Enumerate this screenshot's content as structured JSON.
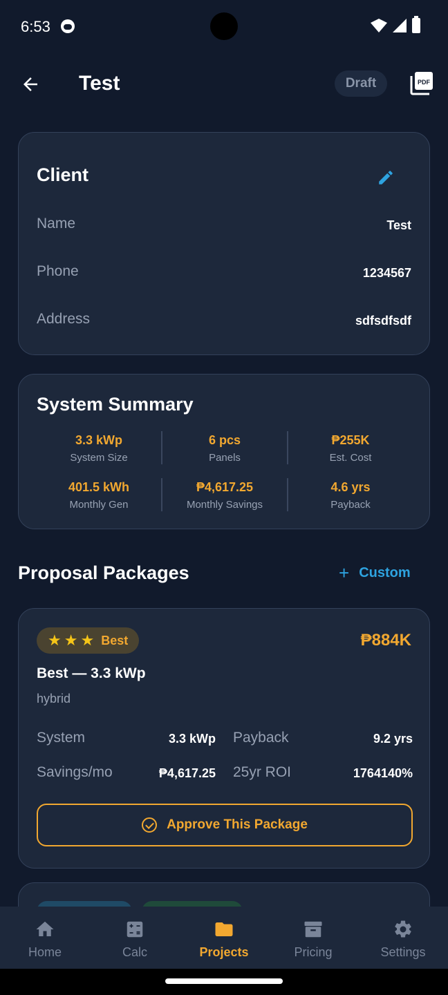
{
  "status_bar": {
    "time": "6:53"
  },
  "header": {
    "title": "Test",
    "status_chip": "Draft",
    "pdf_label": "PDF"
  },
  "client": {
    "title": "Client",
    "rows": [
      {
        "label": "Name",
        "value": "Test"
      },
      {
        "label": "Phone",
        "value": "1234567"
      },
      {
        "label": "Address",
        "value": "sdfsdfsdf"
      }
    ]
  },
  "summary": {
    "title": "System Summary",
    "stats": [
      {
        "value": "3.3 kWp",
        "label": "System Size"
      },
      {
        "value": "6 pcs",
        "label": "Panels"
      },
      {
        "value": "₱255K",
        "label": "Est. Cost"
      },
      {
        "value": "401.5 kWh",
        "label": "Monthly Gen"
      },
      {
        "value": "₱4,617.25",
        "label": "Monthly Savings"
      },
      {
        "value": "4.6 yrs",
        "label": "Payback"
      }
    ]
  },
  "packages": {
    "title": "Proposal Packages",
    "custom_label": "Custom",
    "items": [
      {
        "badge": "Best",
        "stars": 3,
        "price": "₱884K",
        "name": "Best — 3.3 kWp",
        "type": "hybrid",
        "metrics": [
          {
            "label": "System",
            "value": "3.3 kWp"
          },
          {
            "label": "Payback",
            "value": "9.2 yrs"
          },
          {
            "label": "Savings/mo",
            "value": "₱4,617.25"
          },
          {
            "label": "25yr ROI",
            "value": "1764140%"
          }
        ],
        "approve_label": "Approve This Package"
      }
    ]
  },
  "bottom_nav": {
    "items": [
      {
        "label": "Home",
        "icon": "home-icon"
      },
      {
        "label": "Calc",
        "icon": "calculator-icon"
      },
      {
        "label": "Projects",
        "icon": "folder-icon",
        "active": true
      },
      {
        "label": "Pricing",
        "icon": "archive-icon"
      },
      {
        "label": "Settings",
        "icon": "gear-icon"
      }
    ]
  },
  "colors": {
    "background": "#111a2c",
    "card": "#1d283b",
    "accent": "#f2a830",
    "link": "#2ea3e0",
    "muted": "#98a2b3"
  }
}
